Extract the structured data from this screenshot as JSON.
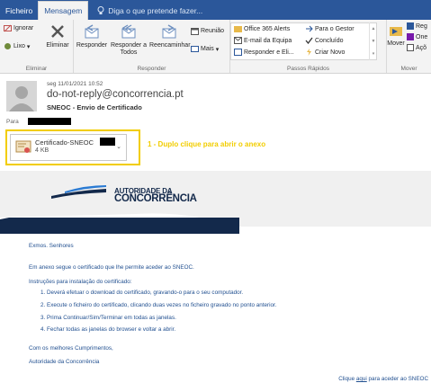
{
  "ribbon": {
    "tabs": [
      "Ficheiro",
      "Mensagem"
    ],
    "active_tab": "Mensagem",
    "tell_me": "Diga o que pretende fazer...",
    "groups": {
      "delete": {
        "label": "Eliminar",
        "ignore": "Ignorar",
        "junk": "Lixo",
        "delete": "Eliminar"
      },
      "respond": {
        "label": "Responder",
        "reply": "Responder",
        "reply_all": "Responder a Todos",
        "forward": "Reencaminhar",
        "meeting": "Reunião",
        "more": "Mais"
      },
      "quick_steps": {
        "label": "Passos Rápidos",
        "items": [
          "Office 365 Alerts",
          "E-mail da Equipa",
          "Responder e Eli...",
          "Para o Gestor",
          "Concluído",
          "Criar Novo"
        ]
      },
      "move": {
        "label": "Mover",
        "move": "Mover",
        "rules": "Reg",
        "onenote": "One",
        "actions": "Açõ"
      }
    },
    "colors": {
      "tabbar": "#2b579a",
      "ribbon_bg": "#f3f3f3"
    }
  },
  "message": {
    "date": "seg 11/01/2021 10:52",
    "sender": "do-not-reply@concorrencia.pt",
    "subject": "SNEOC - Envio de Certificado",
    "to_label": "Para",
    "attachment": {
      "name": "Certificado-SNEOC",
      "size": "4 KB"
    },
    "annotation": "1 - Duplo clique para abrir o anexo",
    "annotation_color": "#f2cd00"
  },
  "banner": {
    "logo_line1": "AUTORIDADE DA",
    "logo_line2": "CONCORRÊNCIA"
  },
  "body": {
    "greeting": "Exmos. Senhores",
    "intro": "Em anexo segue o certificado que lhe permite aceder ao SNEOC.",
    "instructions_title": "Instruções para instalação do certificado:",
    "steps": [
      "1. Deverá efetuar o download do certificado, gravando-o para o seu computador.",
      "2. Execute o ficheiro do certificado, clicando duas vezes no ficheiro gravado no ponto anterior.",
      "3. Prima Continuar/Sim/Terminar em todas as janelas.",
      "4. Fechar todas as janelas do browser e voltar a abrir."
    ],
    "closing": "Com os melhores Cumprimentos,",
    "signature": "Autoridade da Concorrência",
    "footer_pre": "Clique",
    "footer_link": "aqui",
    "footer_post": "para aceder ao SNEOC"
  }
}
